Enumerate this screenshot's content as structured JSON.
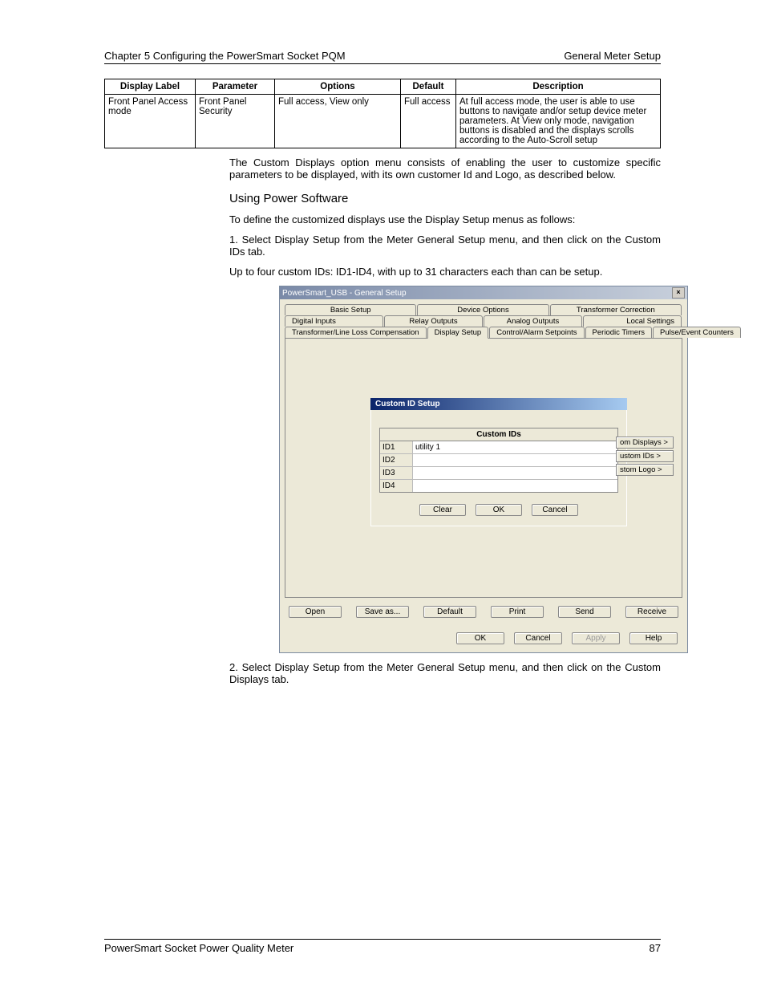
{
  "header": {
    "left": "Chapter 5 Configuring the PowerSmart Socket PQM",
    "right": "General Meter Setup"
  },
  "table": {
    "headers": [
      "Display Label",
      "Parameter",
      "Options",
      "Default",
      "Description"
    ],
    "row": {
      "display_label": "Front Panel Access mode",
      "parameter": "Front Panel Security",
      "options": "Full access, View only",
      "default": "Full access",
      "description": "At full access mode, the user is able to use buttons to navigate and/or setup device meter parameters. At View only mode, navigation buttons is disabled and the displays scrolls according to the Auto-Scroll setup"
    }
  },
  "paragraphs": {
    "intro": "The Custom Displays option menu consists of enabling the user to customize specific parameters to be displayed, with its own customer Id and Logo, as described below.",
    "heading": "Using Power Software",
    "p1": "To define the customized displays use the Display Setup menus as follows:",
    "step1": "1. Select Display Setup from the Meter General Setup menu, and then click on the Custom IDs tab.",
    "p2": "Up to four custom IDs: ID1-ID4, with up to 31 characters each than can be setup.",
    "step2": "2. Select Display Setup from the Meter General Setup menu, and then click on the Custom Displays tab."
  },
  "dialog": {
    "title": "PowerSmart_USB - General Setup",
    "tabs_row1": [
      "Basic Setup",
      "Device Options",
      "Transformer Correction"
    ],
    "tabs_row2": [
      "Digital Inputs",
      "Relay Outputs",
      "Analog Outputs",
      "Local Settings"
    ],
    "tabs_row3": [
      "Transformer/Line Loss Compensation",
      "Display Setup",
      "Control/Alarm Setpoints",
      "Periodic Timers",
      "Pulse/Event Counters"
    ],
    "custom_setup_title": "Custom ID Setup",
    "ids_header": "Custom IDs",
    "id_rows": [
      {
        "label": "ID1",
        "value": "utility 1"
      },
      {
        "label": "ID2",
        "value": ""
      },
      {
        "label": "ID3",
        "value": ""
      },
      {
        "label": "ID4",
        "value": ""
      }
    ],
    "inner_buttons": {
      "clear": "Clear",
      "ok": "OK",
      "cancel": "Cancel"
    },
    "side_buttons": [
      "om Displays >",
      "ustom IDs >",
      "stom Logo >"
    ],
    "bottom_row": [
      "Open",
      "Save as...",
      "Default",
      "Print",
      "Send",
      "Receive"
    ],
    "dlg_buttons": {
      "ok": "OK",
      "cancel": "Cancel",
      "apply": "Apply",
      "help": "Help"
    }
  },
  "footer": {
    "left": "PowerSmart Socket Power Quality Meter",
    "right": "87"
  }
}
